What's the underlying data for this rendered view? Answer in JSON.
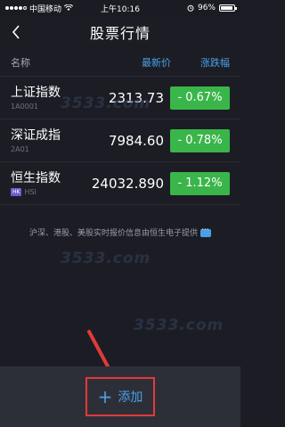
{
  "status_bar": {
    "carrier": "中国移动",
    "time": "上午10:16",
    "battery": "96%",
    "battery_level": 0.96
  },
  "nav": {
    "title": "股票行情",
    "back_icon": "chevron-left-icon"
  },
  "columns": {
    "name": "名称",
    "price": "最新价",
    "change": "涨跌幅"
  },
  "stocks": [
    {
      "name": "上证指数",
      "code": "1A0001",
      "price": "2313.73",
      "change": "- 0.67%",
      "tag": ""
    },
    {
      "name": "深证成指",
      "code": "2A01",
      "price": "7984.60",
      "change": "- 0.78%",
      "tag": ""
    },
    {
      "name": "恒生指数",
      "code": "HSI",
      "price": "24032.890",
      "change": "- 1.12%",
      "tag": "HK"
    }
  ],
  "footnote": "沪深、港股、美股实时报价信息由恒生电子提供",
  "watermark_text": "3533.com",
  "add_button": {
    "plus": "+",
    "label": "添加"
  },
  "colors": {
    "background": "#1c1d24",
    "change_green": "#3ab54a",
    "accent_blue": "#4aa0e8",
    "highlight_red": "#e23a3a"
  }
}
